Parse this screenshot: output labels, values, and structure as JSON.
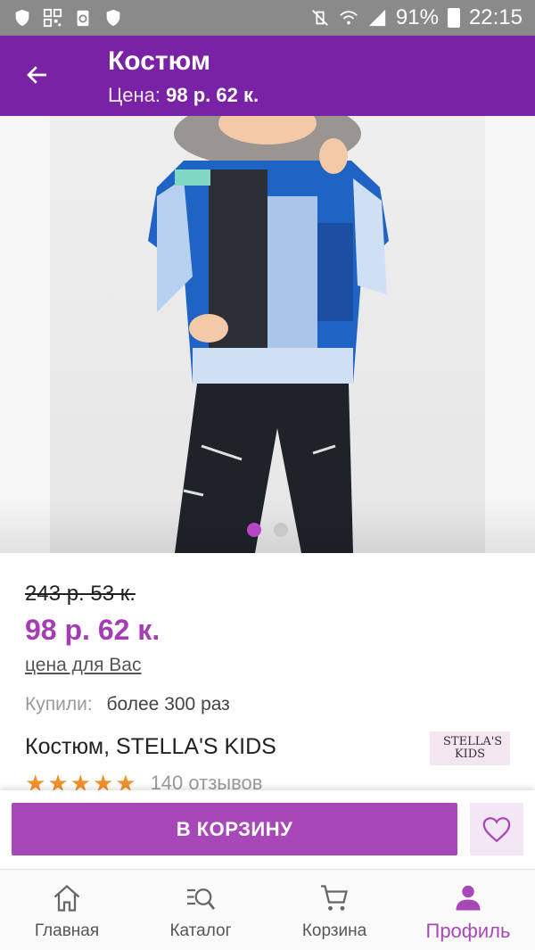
{
  "status_bar": {
    "battery": "91%",
    "time": "22:15"
  },
  "header": {
    "title": "Костюм",
    "price_label": "Цена:",
    "price_value": "98 р. 62 к."
  },
  "gallery": {
    "total": 2,
    "active_index": 0
  },
  "product": {
    "old_price": "243 р. 53 к.",
    "new_price": "98 р. 62 к.",
    "price_for_you": "цена для Вас",
    "bought_label": "Купили:",
    "bought_value": "более 300 раз",
    "name": "Костюм, STELLA'S KIDS",
    "brand_logo_text": "STELLA'S KIDS",
    "rating_stars": 5,
    "reviews": "140 отзывов"
  },
  "actions": {
    "cart_button": "В КОРЗИНУ"
  },
  "bottom_nav": {
    "items": [
      {
        "label": "Главная",
        "icon": "home-icon"
      },
      {
        "label": "Каталог",
        "icon": "catalog-search-icon"
      },
      {
        "label": "Корзина",
        "icon": "cart-icon"
      },
      {
        "label": "Профиль",
        "icon": "profile-icon",
        "active": true
      }
    ]
  },
  "colors": {
    "header": "#7a22a6",
    "accent": "#a847b8",
    "star": "#f0902a"
  }
}
